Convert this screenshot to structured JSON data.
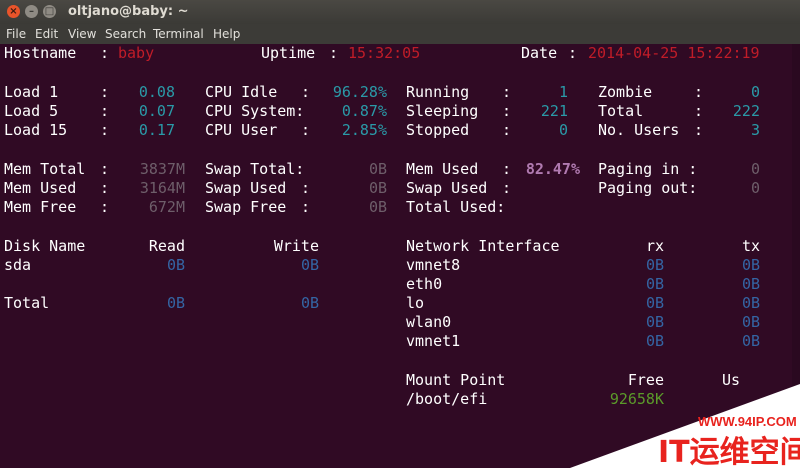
{
  "window": {
    "title": "oltjano@baby: ~",
    "close_glyph": "×",
    "min_glyph": "–",
    "max_glyph": "□"
  },
  "menu": [
    "File",
    "Edit",
    "View",
    "Search",
    "Terminal",
    "Help"
  ],
  "header": {
    "hostname_label": "Hostname",
    "hostname_value": "baby",
    "uptime_label": "Uptime",
    "uptime_value": "15:32:05",
    "date_label": "Date",
    "date_value": "2014-04-25 15:22:19",
    "sep": ":"
  },
  "load": {
    "load1_label": "Load 1",
    "load1": "0.08",
    "load5_label": "Load 5",
    "load5": "0.07",
    "load15_label": "Load 15",
    "load15": "0.17"
  },
  "cpu": {
    "idle_label": "CPU Idle",
    "idle": "96.28%",
    "system_label": "CPU System:",
    "system": "0.87%",
    "user_label": "CPU User",
    "user": "2.85%"
  },
  "procs": {
    "running_label": "Running",
    "running": "1",
    "sleeping_label": "Sleeping",
    "sleeping": "221",
    "stopped_label": "Stopped",
    "stopped": "0",
    "zombie_label": "Zombie",
    "zombie": "0",
    "total_label": "Total",
    "total": "222",
    "users_label": "No. Users",
    "users": "3"
  },
  "mem": {
    "total_label": "Mem Total",
    "total": "3837M",
    "used_label": "Mem Used",
    "used": "3164M",
    "free_label": "Mem Free",
    "free": "672M"
  },
  "swap": {
    "total_label": "Swap Total:",
    "total": "0B",
    "used_label": "Swap Used",
    "used": "0B",
    "free_label": "Swap Free",
    "free": "0B"
  },
  "usage": {
    "mem_used_label": "Mem Used",
    "mem_used": "82.47%",
    "swap_used_label": "Swap Used",
    "total_used_label": "Total Used:",
    "paging_in_label": "Paging in :",
    "paging_in": "0",
    "paging_out_label": "Paging out:",
    "paging_out": "0"
  },
  "disk": {
    "name_header": "Disk Name",
    "read_header": "Read",
    "write_header": "Write",
    "rows": [
      {
        "name": "sda",
        "read": "0B",
        "write": "0B"
      }
    ],
    "total_label": "Total",
    "total_read": "0B",
    "total_write": "0B"
  },
  "net": {
    "iface_header": "Network Interface",
    "rx_header": "rx",
    "tx_header": "tx",
    "rows": [
      {
        "name": "vmnet8",
        "rx": "0B",
        "tx": "0B"
      },
      {
        "name": "eth0",
        "rx": "0B",
        "tx": "0B"
      },
      {
        "name": "lo",
        "rx": "0B",
        "tx": "0B"
      },
      {
        "name": "wlan0",
        "rx": "0B",
        "tx": "0B"
      },
      {
        "name": "vmnet1",
        "rx": "0B",
        "tx": "0B"
      }
    ]
  },
  "mounts": {
    "point_header": "Mount Point",
    "free_header": "Free",
    "used_header": "Us",
    "rows": [
      {
        "point": "/boot/efi",
        "free": "92658K"
      }
    ]
  },
  "watermark": {
    "url": "WWW.94IP.COM",
    "text": "IT运维空间"
  },
  "colors": {
    "terminal_bg": "#300a24",
    "value_red": "#c01c28",
    "value_cyan": "#2a9aa8",
    "value_blue": "#3465a4",
    "value_green": "#5b9a2a",
    "value_magenta": "#b07ab0",
    "watermark_red": "#e8231e"
  }
}
